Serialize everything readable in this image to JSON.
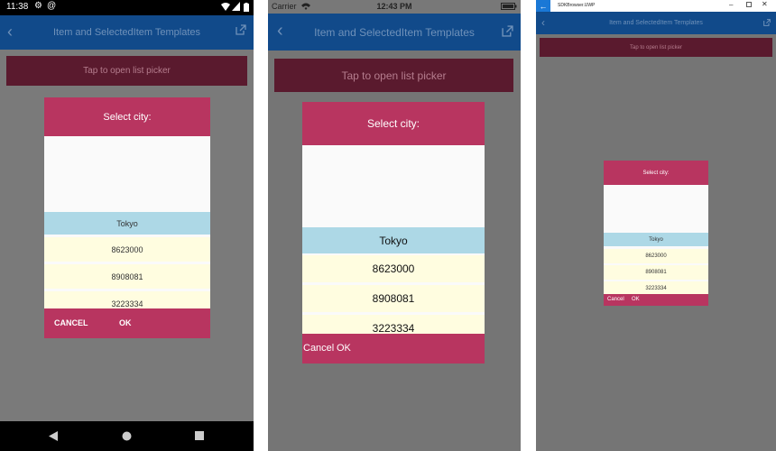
{
  "page_title": "Item and SelectedItem Templates",
  "tap_button_label": "Tap to open list picker",
  "dialog_title": "Select city:",
  "items": [
    "Tokyo",
    "8623000",
    "8908081",
    "3223334"
  ],
  "cancel_label": "Cancel",
  "ok_label": "OK",
  "android": {
    "status_time": "11:38",
    "cancel_label": "CANCEL",
    "ok_label": "OK"
  },
  "ios": {
    "carrier": "Carrier",
    "time": "12:43 PM"
  },
  "uwp": {
    "window_title": "SDKBrowser.UWP"
  },
  "colors": {
    "android_statusbar": "#000000",
    "navbar_blue": "#1a5aa0",
    "navbar_dim": "#114a8a",
    "overlay": "#757575",
    "tap_button": "#5a1a2e",
    "dialog_accent": "#b83560",
    "selected_row": "#add8e6",
    "normal_row": "#fffde0"
  }
}
